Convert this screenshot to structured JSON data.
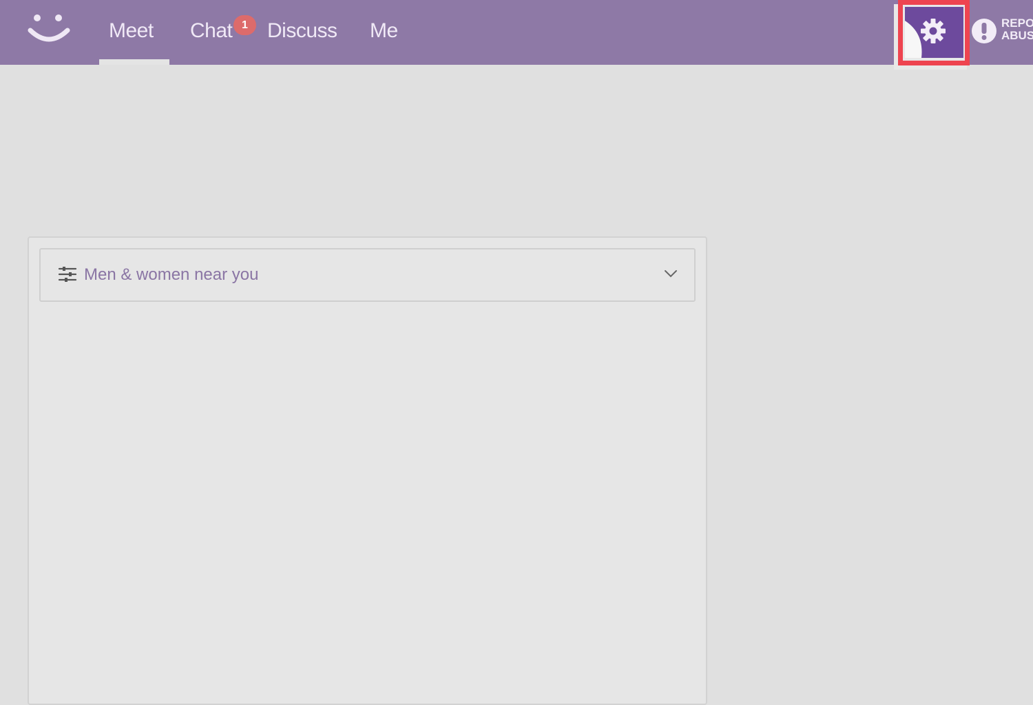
{
  "nav": {
    "items": [
      {
        "label": "Meet"
      },
      {
        "label": "Chat"
      },
      {
        "label": "Discuss"
      },
      {
        "label": "Me"
      }
    ],
    "chat_badge": "1",
    "active_tab": "Meet"
  },
  "header": {
    "settings_icon": "gear-icon",
    "report": {
      "label": "REPORT\nABUSE",
      "icon": "exclamation-icon"
    }
  },
  "filter": {
    "label": "Men & women near you",
    "icon": "sliders-icon",
    "chevron": "chevron-down-icon"
  },
  "colors": {
    "header_bg": "#8e79a6",
    "settings_bg": "#6d4a9d",
    "highlight": "#ee4450",
    "badge": "#dd6b6b",
    "accent_text": "#8a75a4"
  }
}
